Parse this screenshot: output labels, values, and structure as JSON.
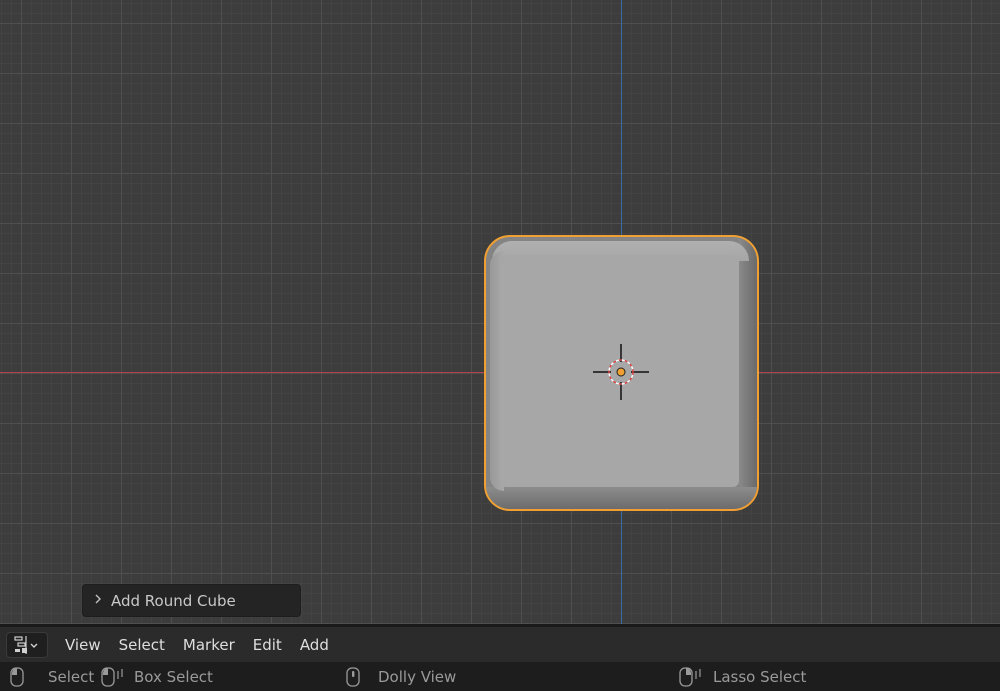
{
  "viewport": {
    "axis_x_color": "#b4414e",
    "axis_y_color": "#3a6aa8",
    "selection_outline_color": "#f0a032",
    "object": {
      "name_icon": "round-cube-mesh",
      "selected": true
    },
    "cursor_icon": "3d-cursor-icon",
    "origin_icon": "object-origin-icon"
  },
  "redo_panel": {
    "icon": "chevron-right-icon",
    "label": "Add Round Cube"
  },
  "header": {
    "editor_type_icon": "timeline-editor-icon",
    "menus": [
      "View",
      "Select",
      "Marker",
      "Edit",
      "Add"
    ]
  },
  "statusbar": {
    "items": [
      {
        "icon": "mouse-left-icon",
        "label": "Select"
      },
      {
        "icon": "mouse-drag-icon",
        "label": "Box Select"
      },
      {
        "icon": "mouse-middle-icon",
        "label": "Dolly View"
      },
      {
        "icon": "mouse-right-icon",
        "label": "Lasso Select"
      }
    ]
  }
}
